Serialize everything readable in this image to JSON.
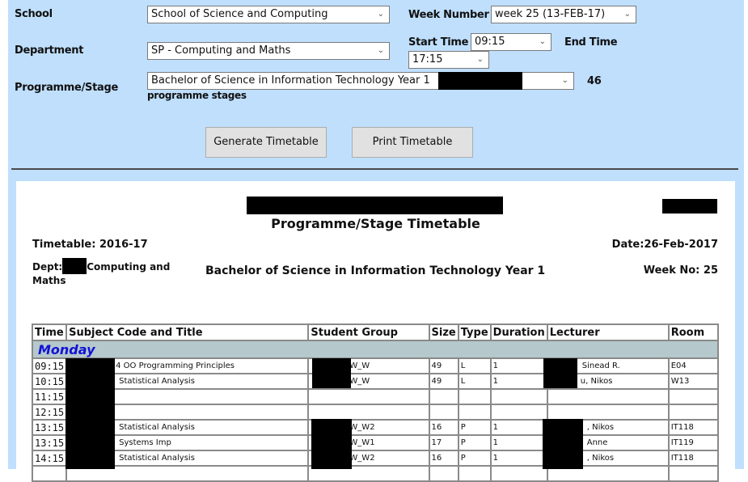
{
  "form": {
    "school_label": "School",
    "school_value": "School of Science and Computing",
    "department_label": "Department",
    "department_value": "SP - Computing and Maths",
    "programme_label": "Programme/Stage",
    "programme_value": "Bachelor of Science in Information Technology Year 1",
    "programme_count": "46",
    "programme_count_suffix": "programme stages",
    "week_label": "Week Number",
    "week_value": "week 25 (13-FEB-17)",
    "start_label": "Start Time",
    "start_value": "09:15",
    "end_label": "End Time",
    "end_value": "17:15",
    "generate_button": "Generate Timetable",
    "print_button": "Print Timetable"
  },
  "timetable": {
    "title": "Programme/Stage Timetable",
    "timetable_year": "Timetable: 2016-17",
    "date": "Date:26-Feb-2017",
    "dept_prefix": "Dept:",
    "dept_name": "Computing and Maths",
    "programme": "Bachelor of Science in Information Technology Year 1",
    "week_no": "Week No: 25",
    "columns": [
      "Time",
      "Subject Code and Title",
      "Student Group",
      "Size",
      "Type",
      "Duration",
      "Lecturer",
      "Room"
    ],
    "day": "Monday",
    "rows": [
      {
        "time": "09:15",
        "subject": "4 OO Programming Principles",
        "group": "W_W",
        "size": "49",
        "type": "L",
        "duration": "1",
        "lecturer": "Sinead R.",
        "room": "E04"
      },
      {
        "time": "10:15",
        "subject": "Statistical Analysis",
        "group": "W_W",
        "size": "49",
        "type": "L",
        "duration": "1",
        "lecturer": "u, Nikos",
        "room": "W13"
      },
      {
        "time": "11:15",
        "subject": "",
        "group": "",
        "size": "",
        "type": "",
        "duration": "",
        "lecturer": "",
        "room": ""
      },
      {
        "time": "12:15",
        "subject": "",
        "group": "",
        "size": "",
        "type": "",
        "duration": "",
        "lecturer": "",
        "room": ""
      },
      {
        "time": "13:15",
        "subject": "Statistical Analysis",
        "group": "W_W2",
        "size": "16",
        "type": "P",
        "duration": "1",
        "lecturer": ", Nikos",
        "room": "IT118"
      },
      {
        "time": "13:15",
        "subject": "Systems Imp",
        "group": "W_W1",
        "size": "17",
        "type": "P",
        "duration": "1",
        "lecturer": "Anne",
        "room": "IT119"
      },
      {
        "time": "14:15",
        "subject": "Statistical Analysis",
        "group": "W_W2",
        "size": "16",
        "type": "P",
        "duration": "1",
        "lecturer": ", Nikos",
        "room": "IT118"
      }
    ]
  }
}
